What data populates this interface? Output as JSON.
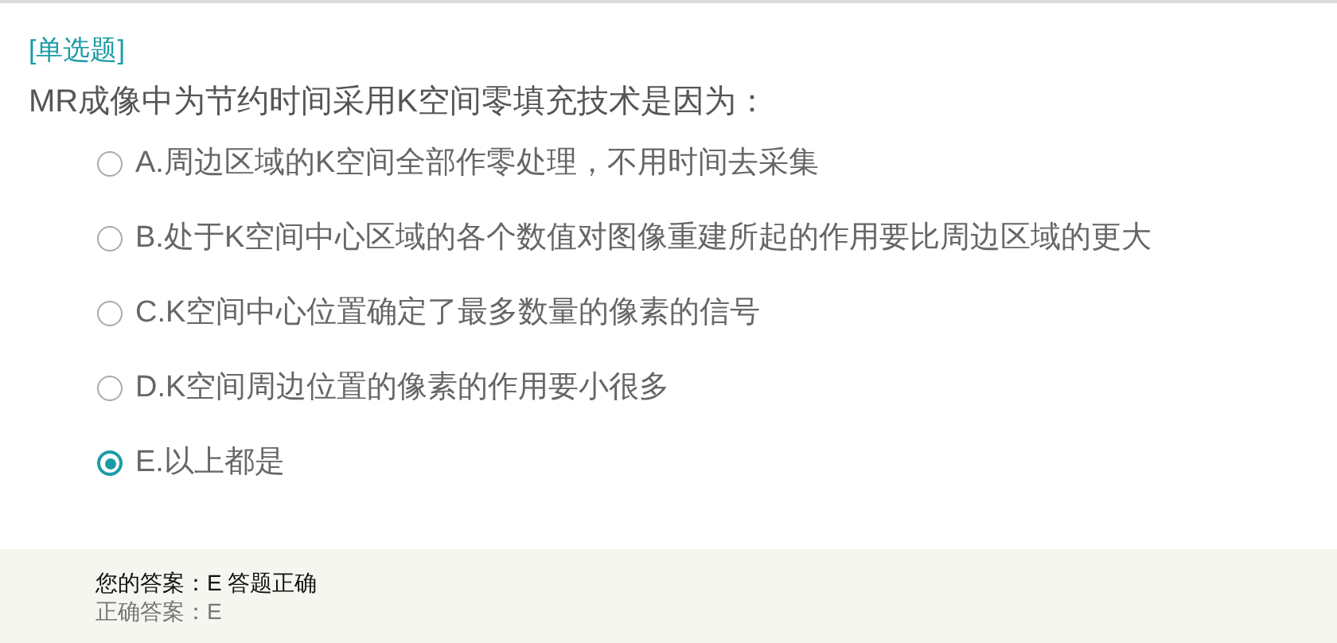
{
  "question_type": "[单选题]",
  "question": "MR成像中为节约时间采用K空间零填充技术是因为：",
  "options": [
    {
      "label": "A.周边区域的K空间全部作零处理，不用时间去采集",
      "selected": false
    },
    {
      "label": "B.处于K空间中心区域的各个数值对图像重建所起的作用要比周边区域的更大",
      "selected": false
    },
    {
      "label": "C.K空间中心位置确定了最多数量的像素的信号",
      "selected": false
    },
    {
      "label": "D.K空间周边位置的像素的作用要小很多",
      "selected": false
    },
    {
      "label": "E.以上都是",
      "selected": true
    }
  ],
  "result": {
    "your_answer": "您的答案：E 答题正确",
    "correct_answer": "正确答案：E"
  }
}
